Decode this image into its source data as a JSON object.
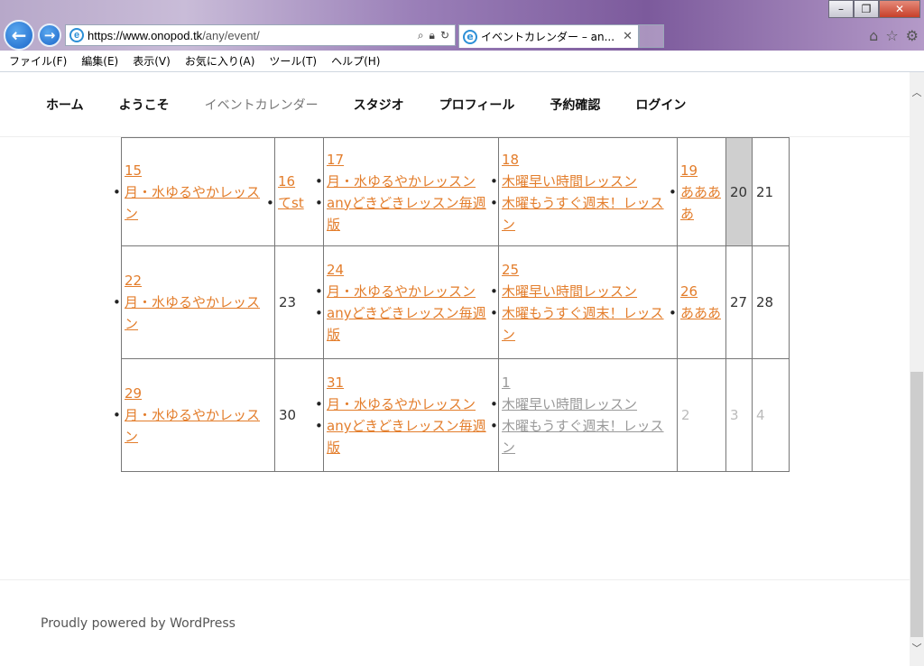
{
  "browser": {
    "url_host": "https://www.onopod.tk",
    "url_path": "/any/event/",
    "tab_title": "イベントカレンダー – an...",
    "menu": [
      "ファイル(F)",
      "編集(E)",
      "表示(V)",
      "お気に入り(A)",
      "ツール(T)",
      "ヘルプ(H)"
    ]
  },
  "nav": [
    "ホーム",
    "ようこそ",
    "イベントカレンダー",
    "スタジオ",
    "プロフィール",
    "予約確認",
    "ログイン"
  ],
  "calendar": {
    "rows": [
      {
        "mon": {
          "day": "15",
          "events": [
            "月・水ゆるやかレッスン"
          ]
        },
        "tue": {
          "day": "16",
          "events": [
            "てst"
          ]
        },
        "wed": {
          "day": "17",
          "events": [
            "月・水ゆるやかレッスン",
            "anyどきどきレッスン毎週版"
          ]
        },
        "thu": {
          "day": "18",
          "events": [
            "木曜早い時間レッスン",
            "木曜もうすぐ週末！レッスン"
          ]
        },
        "fri": {
          "day": "19",
          "events": [
            "ああああ"
          ]
        },
        "sat": "20",
        "sun": "21"
      },
      {
        "mon": {
          "day": "22",
          "events": [
            "月・水ゆるやかレッスン"
          ]
        },
        "tue": "23",
        "wed": {
          "day": "24",
          "events": [
            "月・水ゆるやかレッスン",
            "anyどきどきレッスン毎週版"
          ]
        },
        "thu": {
          "day": "25",
          "events": [
            "木曜早い時間レッスン",
            "木曜もうすぐ週末！レッスン"
          ]
        },
        "fri": {
          "day": "26",
          "events": [
            "あああ"
          ]
        },
        "sat": "27",
        "sun": "28"
      },
      {
        "mon": {
          "day": "29",
          "events": [
            "月・水ゆるやかレッスン"
          ]
        },
        "tue": "30",
        "wed": {
          "day": "31",
          "events": [
            "月・水ゆるやかレッスン",
            "anyどきどきレッスン毎週版"
          ]
        },
        "thu": {
          "day": "1",
          "events": [
            "木曜早い時間レッスン",
            "木曜もうすぐ週末！レッスン"
          ]
        },
        "fri": "2",
        "sat": "3",
        "sun": "4"
      }
    ]
  },
  "footer": "Proudly powered by WordPress",
  "colors": {
    "link": "#e37d2b",
    "today_bg": "#cfcfcf"
  }
}
